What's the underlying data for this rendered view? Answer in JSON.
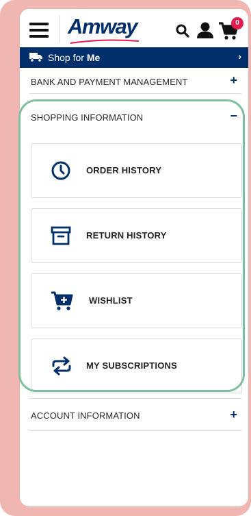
{
  "header": {
    "logo_text": "Amway",
    "cart_count": "0",
    "icons": [
      "hamburger-menu-icon",
      "search-icon",
      "user-icon",
      "cart-icon"
    ]
  },
  "shop_for": {
    "prefix": "Shop for",
    "who": "Me",
    "icon": "truck-icon"
  },
  "sections": {
    "bank": {
      "label": "BANK AND PAYMENT MANAGEMENT",
      "sign": "+"
    },
    "shopping": {
      "label": "SHOPPING INFORMATION",
      "sign": "−"
    },
    "account": {
      "label": "ACCOUNT INFORMATION",
      "sign": "+"
    }
  },
  "shopping_items": [
    {
      "label": "ORDER HISTORY",
      "icon": "clock-icon"
    },
    {
      "label": "RETURN HISTORY",
      "icon": "archive-box-icon"
    },
    {
      "label": "WISHLIST",
      "icon": "cart-plus-icon"
    },
    {
      "label": "MY SUBSCRIPTIONS",
      "icon": "repeat-icon"
    }
  ],
  "colors": {
    "navy": "#002f6c",
    "badge": "#e21a4d",
    "frame": "#efb6b2",
    "highlight": "#7fbfa0"
  }
}
